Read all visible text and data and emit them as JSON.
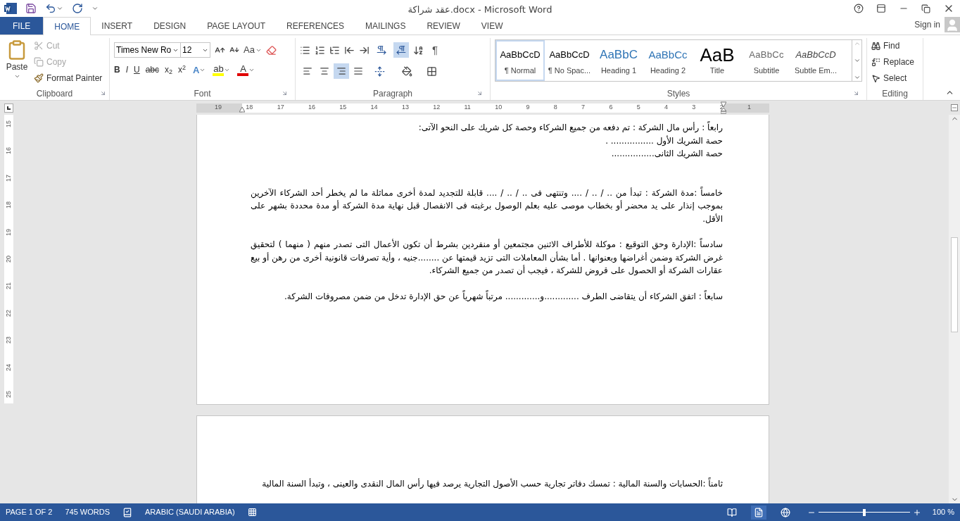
{
  "window": {
    "title": "عقد شراكة.docx - Microsoft Word"
  },
  "account": {
    "label": "Sign in"
  },
  "tabs": [
    {
      "label": "FILE",
      "kind": "file",
      "selected": false
    },
    {
      "label": "HOME",
      "kind": "tab",
      "selected": true
    },
    {
      "label": "INSERT",
      "kind": "tab",
      "selected": false
    },
    {
      "label": "DESIGN",
      "kind": "tab",
      "selected": false
    },
    {
      "label": "PAGE LAYOUT",
      "kind": "tab",
      "selected": false
    },
    {
      "label": "REFERENCES",
      "kind": "tab",
      "selected": false
    },
    {
      "label": "MAILINGS",
      "kind": "tab",
      "selected": false
    },
    {
      "label": "REVIEW",
      "kind": "tab",
      "selected": false
    },
    {
      "label": "VIEW",
      "kind": "tab",
      "selected": false
    }
  ],
  "clipboard": {
    "title": "Clipboard",
    "paste": "Paste",
    "items": [
      {
        "label": "Cut",
        "kind": "cut",
        "disabled": true
      },
      {
        "label": "Copy",
        "kind": "copy",
        "disabled": true
      },
      {
        "label": "Format Painter",
        "kind": "painter",
        "disabled": false
      }
    ]
  },
  "font": {
    "title": "Font",
    "name": "Times New Ro",
    "size": "12",
    "case": "Aa",
    "format_buttons": [
      {
        "label": "B",
        "kind": "bold"
      },
      {
        "label": "I",
        "kind": "italic"
      },
      {
        "label": "U",
        "kind": "underline"
      },
      {
        "label": "abc",
        "kind": "strike"
      },
      {
        "label": "x$_{2}$",
        "kind": "sub"
      },
      {
        "label": "x$^{2}$",
        "kind": "sup"
      }
    ],
    "color_buttons": [
      {
        "label": "A",
        "kind": "effect",
        "color": "#4a86c8"
      },
      {
        "label": "ab",
        "kind": "highlight",
        "color": "#ffff00"
      },
      {
        "label": "A",
        "kind": "font_color",
        "color": "#e00000"
      }
    ]
  },
  "paragraph": {
    "title": "Paragraph",
    "show_marks": "¶",
    "direction": [
      {
        "kind": "ltr",
        "selected": false
      },
      {
        "kind": "rtl",
        "selected": true
      }
    ],
    "alignment": [
      {
        "kind": "left",
        "selected": false
      },
      {
        "kind": "center",
        "selected": false
      },
      {
        "kind": "right",
        "selected": true
      },
      {
        "kind": "justify",
        "selected": false
      }
    ]
  },
  "styles": {
    "title": "Styles",
    "items": [
      {
        "preview": "AaBbCcD",
        "label": "¶ Normal",
        "kind": "normal",
        "selected": true
      },
      {
        "preview": "AaBbCcD",
        "label": "¶ No Spac...",
        "kind": "normal",
        "selected": false
      },
      {
        "preview": "AaBbC",
        "label": "Heading 1",
        "kind": "heading1",
        "selected": false
      },
      {
        "preview": "AaBbCc",
        "label": "Heading 2",
        "kind": "heading2",
        "selected": false
      },
      {
        "preview": "AaB",
        "label": "Title",
        "kind": "title",
        "selected": false
      },
      {
        "preview": "AaBbCc",
        "label": "Subtitle",
        "kind": "subtitle",
        "selected": false
      },
      {
        "preview": "AaBbCcD",
        "label": "Subtle Em...",
        "kind": "emphasis",
        "selected": false
      }
    ]
  },
  "editing": {
    "title": "Editing",
    "items": [
      {
        "label": "Find",
        "kind": "find"
      },
      {
        "label": "Replace",
        "kind": "replace"
      },
      {
        "label": "Select",
        "kind": "select"
      }
    ]
  },
  "h_ruler": [
    "19",
    "18",
    "17",
    "16",
    "15",
    "14",
    "13",
    "12",
    "11",
    "10",
    "9",
    "8",
    "7",
    "6",
    "5",
    "4",
    "3",
    "2",
    "1"
  ],
  "v_ruler": [
    "15",
    "16",
    "17",
    "18",
    "19",
    "20",
    "21",
    "22",
    "23",
    "24",
    "25"
  ],
  "pages": [
    {
      "paragraphs": [
        {
          "text": "رابعاً : رأس مال الشركة : تم دفعه من جميع الشركاء وحصة كل شريك على النحو الآتى:",
          "kind": "tight"
        },
        {
          "text": "حصة الشريك الأول ................ .",
          "kind": "tight"
        },
        {
          "text": "حصة الشريك الثانى................",
          "kind": "tight"
        },
        {
          "text": "خامساً :مدة الشركة : تبدأ من .. / .. / .... وتنتهى فى .. / .. / .... قابلة للتجديد لمدة أخرى مماثلة ما لم يخطر أحد الشركاء الآخرين بموجب إنذار على يد محضر أو بخطاب موصى عليه بعلم الوصول برغبته فى الانفصال قبل نهاية مدة الشركة أو مدة محددة بشهر على الأقل.",
          "kind": "far"
        },
        {
          "text": "سادساً :الإدارة وحق التوقيع : موكلة للأطراف الاثنين مجتمعين أو منفردين بشرط أن تكون الأعمال التى تصدر منهم ( منهما ) لتحقيق غرض الشركة وضمن أغراضها وبعنوانها . أما بشأن المعاملات التى تزيد قيمتها عن ........جنيه ، وأية تصرفات قانونية أخرى من رهن أو بيع عقارات الشركة أو الحصول على قروض للشركة ، فيجب أن تصدر من جميع الشركاء.",
          "kind": "spaced"
        },
        {
          "text": "سابعاً : اتفق الشركاء أن يتقاضى الطرف .............و............. مرتباً شهرياً عن حق الإدارة تدخل من ضمن مصروفات الشركة.",
          "kind": "spaced"
        }
      ]
    },
    {
      "paragraphs": [
        {
          "text": "ثامناً :الحسابات والسنة المالية : تمسك دفاتر تجارية حسب الأصول التجارية يرصد فيها رأس المال النقدى والعينى ، وتبدأ السنة المالية",
          "kind": "tight"
        }
      ]
    }
  ],
  "status_bar": {
    "page": "PAGE 1 OF 2",
    "words": "745 WORDS",
    "language": "ARABIC (SAUDI ARABIA)",
    "views": [
      {
        "kind": "read",
        "selected": false
      },
      {
        "kind": "print",
        "selected": true
      },
      {
        "kind": "web",
        "selected": false
      }
    ],
    "zoom": {
      "level": 0.5,
      "label": "100 %"
    }
  }
}
